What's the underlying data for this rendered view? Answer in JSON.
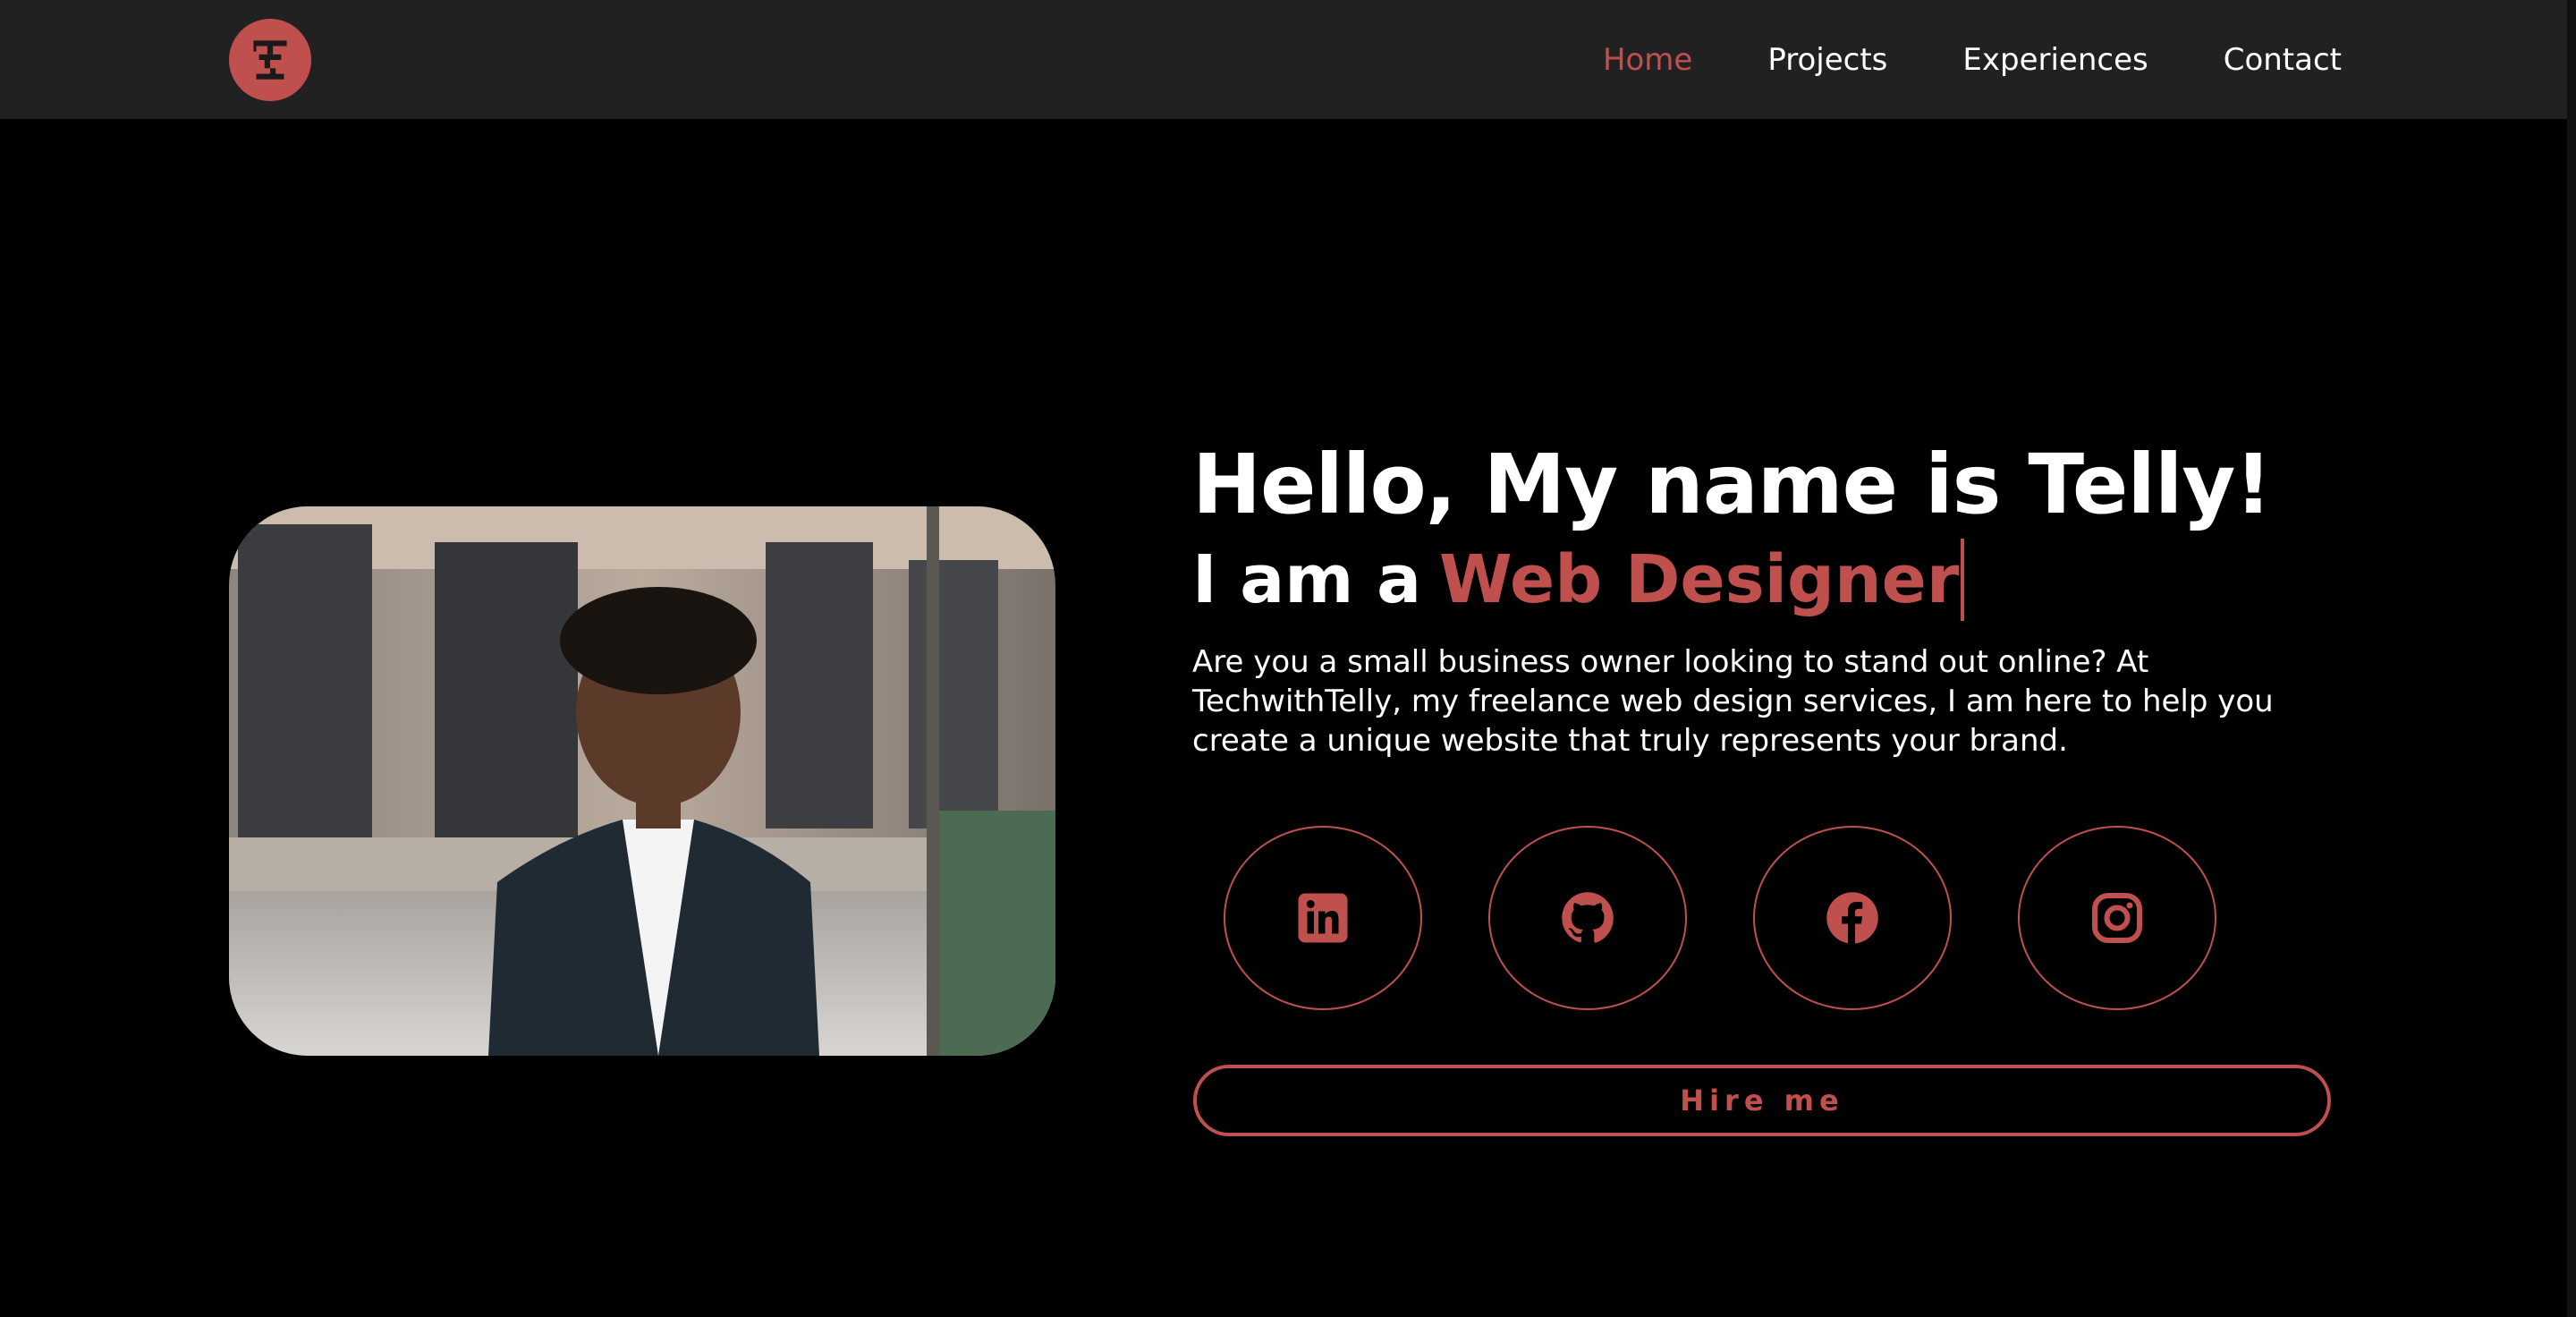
{
  "colors": {
    "accent": "#c0504d",
    "nav_bg": "#212121",
    "page_bg": "#000000",
    "text": "#ffffff"
  },
  "logo": {
    "icon": "tt-monogram-logo"
  },
  "nav": {
    "items": [
      {
        "label": "Home",
        "active": true
      },
      {
        "label": "Projects",
        "active": false
      },
      {
        "label": "Experiences",
        "active": false
      },
      {
        "label": "Contact",
        "active": false
      }
    ]
  },
  "hero": {
    "title": "Hello, My name is Telly!",
    "subtitle_prefix": "I am a",
    "subtitle_role": "Web Designer",
    "description": "Are you a small business owner looking to stand out online? At TechwithTelly, my freelance web design services, I am here to help you create a unique website that truly represents your brand.",
    "photo_icon": "portrait-photo"
  },
  "socials": [
    {
      "icon": "linkedin-icon"
    },
    {
      "icon": "github-icon"
    },
    {
      "icon": "facebook-icon"
    },
    {
      "icon": "instagram-icon"
    }
  ],
  "cta": {
    "label": "Hire me"
  }
}
